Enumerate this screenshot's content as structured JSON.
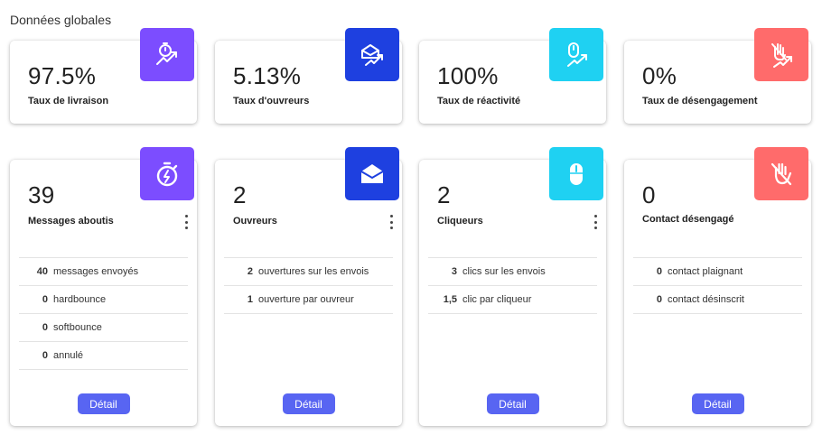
{
  "section_title": "Données globales",
  "colors": {
    "purple": "#7c4dff",
    "blue": "#1e40e0",
    "cyan": "#1fd1f2",
    "red": "#ff6b6b",
    "button": "#5865f2"
  },
  "rate_cards": [
    {
      "value": "97.5%",
      "label": "Taux de livraison",
      "icon": "stopwatch-trend-icon",
      "color": "#7c4dff"
    },
    {
      "value": "5.13%",
      "label": "Taux d'ouvreurs",
      "icon": "envelope-trend-icon",
      "color": "#1e40e0"
    },
    {
      "value": "100%",
      "label": "Taux de réactivité",
      "icon": "mouse-trend-icon",
      "color": "#1fd1f2"
    },
    {
      "value": "0%",
      "label": "Taux de désengagement",
      "icon": "hand-off-trend-icon",
      "color": "#ff6b6b"
    }
  ],
  "detail_cards": [
    {
      "value": "39",
      "label": "Messages aboutis",
      "icon": "stopwatch-icon",
      "color": "#7c4dff",
      "has_menu": true,
      "rows": [
        {
          "num": "40",
          "text": "messages envoyés"
        },
        {
          "num": "0",
          "text": "hardbounce"
        },
        {
          "num": "0",
          "text": "softbounce"
        },
        {
          "num": "0",
          "text": "annulé"
        }
      ],
      "button": "Détail"
    },
    {
      "value": "2",
      "label": "Ouvreurs",
      "icon": "envelope-icon",
      "color": "#1e40e0",
      "has_menu": true,
      "rows": [
        {
          "num": "2",
          "text": "ouvertures sur les envois"
        },
        {
          "num": "1",
          "text": "ouverture par ouvreur"
        }
      ],
      "button": "Détail"
    },
    {
      "value": "2",
      "label": "Cliqueurs",
      "icon": "mouse-icon",
      "color": "#1fd1f2",
      "has_menu": true,
      "rows": [
        {
          "num": "3",
          "text": "clics sur les envois"
        },
        {
          "num": "1,5",
          "text": "clic par cliqueur"
        }
      ],
      "button": "Détail"
    },
    {
      "value": "0",
      "label": "Contact désengagé",
      "icon": "hand-off-icon",
      "color": "#ff6b6b",
      "has_menu": false,
      "rows": [
        {
          "num": "0",
          "text": "contact plaignant"
        },
        {
          "num": "0",
          "text": "contact désinscrit"
        }
      ],
      "button": "Détail"
    }
  ]
}
